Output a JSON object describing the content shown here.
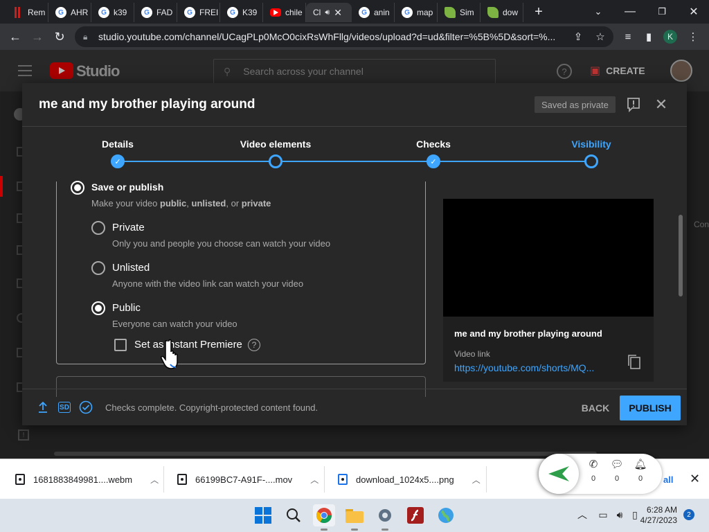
{
  "browser": {
    "tabs": [
      {
        "label": "Rem",
        "icon": "red-bars-icon"
      },
      {
        "label": "AHR",
        "icon": "google-icon"
      },
      {
        "label": "k39",
        "icon": "google-icon"
      },
      {
        "label": "FAD",
        "icon": "google-icon"
      },
      {
        "label": "FREI",
        "icon": "google-icon"
      },
      {
        "label": "K39",
        "icon": "google-icon"
      },
      {
        "label": "chile",
        "icon": "youtube-icon"
      },
      {
        "label": "Cl",
        "icon": "studio-icon"
      },
      {
        "label": "anin",
        "icon": "google-icon"
      },
      {
        "label": "map",
        "icon": "google-icon"
      },
      {
        "label": "Sim",
        "icon": "leaf-icon"
      },
      {
        "label": "dow",
        "icon": "leaf-icon"
      }
    ],
    "url": "studio.youtube.com/channel/UCagPLp0McO0cixRsWhFllg/videos/upload?d=ud&filter=%5B%5D&sort=%...",
    "profile_initial": "K"
  },
  "studio": {
    "logo_text": "Studio",
    "search_placeholder": "Search across your channel",
    "create_label": "CREATE",
    "side_text": "Con"
  },
  "dialog": {
    "title": "me and my brother playing around",
    "saved_badge": "Saved as private",
    "steps": [
      {
        "label": "Details",
        "state": "done"
      },
      {
        "label": "Video elements",
        "state": "pending"
      },
      {
        "label": "Checks",
        "state": "done"
      },
      {
        "label": "Visibility",
        "state": "current"
      }
    ],
    "visibility": {
      "save_title": "Save or publish",
      "save_desc_pre": "Make your video ",
      "save_desc_public": "public",
      "save_desc_sep1": ", ",
      "save_desc_unlisted": "unlisted",
      "save_desc_sep2": ", or ",
      "save_desc_private": "private",
      "options": [
        {
          "title": "Private",
          "desc": "Only you and people you choose can watch your video",
          "selected": false
        },
        {
          "title": "Unlisted",
          "desc": "Anyone with the video link can watch your video",
          "selected": false
        },
        {
          "title": "Public",
          "desc": "Everyone can watch your video",
          "selected": true
        }
      ],
      "premiere_label": "Set as instant Premiere",
      "premiere_help": "?"
    },
    "preview": {
      "title": "me and my brother playing around",
      "link_label": "Video link",
      "link": "https://youtube.com/shorts/MQ..."
    },
    "footer": {
      "sd_label": "SD",
      "status": "Checks complete. Copyright-protected content found.",
      "back_label": "BACK",
      "publish_label": "PUBLISH"
    }
  },
  "downloads": {
    "items": [
      {
        "name": "1681883849981....webm"
      },
      {
        "name": "66199BC7-A91F-....mov"
      },
      {
        "name": "download_1024x5....png"
      }
    ],
    "notif_counts": {
      "calls": "0",
      "messages": "0",
      "alerts": "0"
    },
    "show_all": "all"
  },
  "taskbar": {
    "time": "6:28 AM",
    "date": "4/27/2023",
    "notification_count": "2"
  },
  "colors": {
    "accent": "#3ea6ff",
    "dialog_bg": "#282828",
    "yt_red": "#ff0000"
  }
}
